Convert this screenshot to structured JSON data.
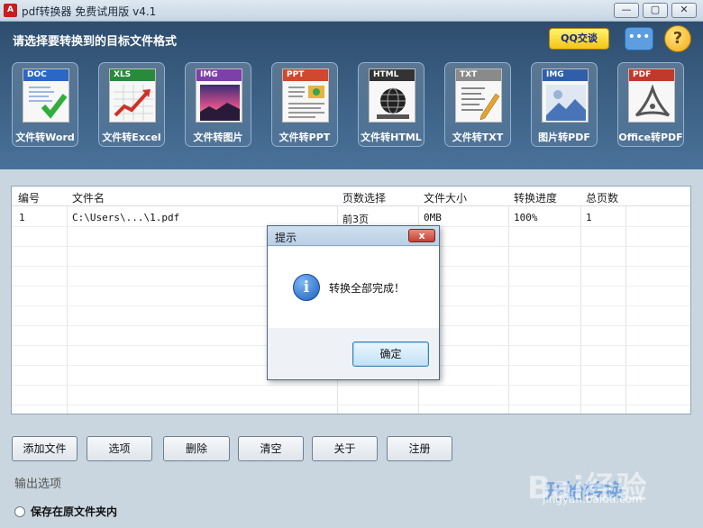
{
  "window": {
    "title": "pdf转换器 免费试用版 v4.1",
    "app_icon": "pdf-logo",
    "controls": [
      "minimize",
      "maximize",
      "close"
    ]
  },
  "header": {
    "label": "请选择要转换到的目标文件格式",
    "qq_button": "QQ交谈",
    "chat_icon": "speech-bubble-icon",
    "help_icon": "?"
  },
  "tools": [
    {
      "tag": "DOC",
      "label": "文件转Word",
      "tag_color": "#2b68c6"
    },
    {
      "tag": "XLS",
      "label": "文件转Excel",
      "tag_color": "#2a8a3c"
    },
    {
      "tag": "IMG",
      "label": "文件转图片",
      "tag_color": "#7d3fa8"
    },
    {
      "tag": "PPT",
      "label": "文件转PPT",
      "tag_color": "#d0482d"
    },
    {
      "tag": "HTML",
      "label": "文件转HTML",
      "tag_color": "#333333"
    },
    {
      "tag": "TXT",
      "label": "文件转TXT",
      "tag_color": "#8a8a8a"
    },
    {
      "tag": "IMG",
      "label": "图片转PDF",
      "tag_color": "#2f5fa8"
    },
    {
      "tag": "PDF",
      "label": "Office转PDF",
      "tag_color": "#c0392b"
    }
  ],
  "table": {
    "headers": [
      "编号",
      "文件名",
      "页数选择",
      "文件大小",
      "转换进度",
      "总页数"
    ],
    "rows": [
      [
        "1",
        "C:\\Users\\...\\1.pdf",
        "前3页",
        "0MB",
        "100%",
        "1"
      ]
    ]
  },
  "dialog": {
    "title": "提示",
    "close": "x",
    "message": "转换全部完成！",
    "ok_label": "确定",
    "icon": "info-icon"
  },
  "buttons": [
    "添加文件",
    "选项",
    "删除",
    "清空",
    "关于",
    "注册"
  ],
  "output": {
    "section_label": "输出选项",
    "radio_label": "保存在原文件夹内"
  },
  "watermark": {
    "brand": "Bai经验",
    "url": "jingyan.baidu.com",
    "start_label": "开始转换"
  }
}
